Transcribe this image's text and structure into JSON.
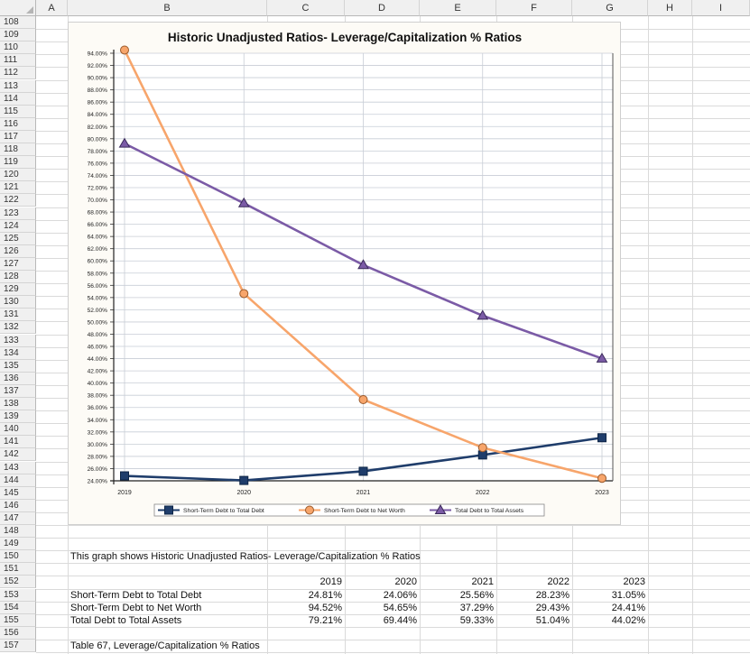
{
  "columns": [
    {
      "id": "corner",
      "label": ""
    },
    {
      "id": "A",
      "label": "A"
    },
    {
      "id": "B",
      "label": "B"
    },
    {
      "id": "C",
      "label": "C"
    },
    {
      "id": "D",
      "label": "D"
    },
    {
      "id": "E",
      "label": "E"
    },
    {
      "id": "F",
      "label": "F"
    },
    {
      "id": "G",
      "label": "G"
    },
    {
      "id": "H",
      "label": "H"
    },
    {
      "id": "I",
      "label": "I"
    }
  ],
  "rows": [
    "108",
    "109",
    "110",
    "111",
    "112",
    "113",
    "114",
    "115",
    "116",
    "117",
    "118",
    "119",
    "120",
    "121",
    "122",
    "123",
    "124",
    "125",
    "126",
    "127",
    "128",
    "129",
    "130",
    "131",
    "132",
    "133",
    "134",
    "135",
    "136",
    "137",
    "138",
    "139",
    "140",
    "141",
    "142",
    "143",
    "144",
    "145",
    "146",
    "147",
    "148",
    "149",
    "150",
    "151",
    "152",
    "153",
    "154",
    "155",
    "156",
    "157"
  ],
  "description": "This graph shows Historic Unadjusted Ratios- Leverage/Capitalization % Ratios",
  "table": {
    "years": [
      "2019",
      "2020",
      "2021",
      "2022",
      "2023"
    ],
    "rows": [
      {
        "label": "Short-Term Debt to Total Debt",
        "values": [
          "24.81%",
          "24.06%",
          "25.56%",
          "28.23%",
          "31.05%"
        ]
      },
      {
        "label": "Short-Term Debt to Net Worth",
        "values": [
          "94.52%",
          "54.65%",
          "37.29%",
          "29.43%",
          "24.41%"
        ]
      },
      {
        "label": "Total Debt to Total Assets",
        "values": [
          "79.21%",
          "69.44%",
          "59.33%",
          "51.04%",
          "44.02%"
        ]
      }
    ]
  },
  "caption": "Table 67, Leverage/Capitalization % Ratios",
  "chart_data": {
    "type": "line",
    "title": "Historic Unadjusted Ratios- Leverage/Capitalization % Ratios",
    "x": [
      "2019",
      "2020",
      "2021",
      "2022",
      "2023"
    ],
    "ylim": [
      24,
      94
    ],
    "yticks": [
      "94.00%",
      "92.00%",
      "90.00%",
      "88.00%",
      "86.00%",
      "84.00%",
      "82.00%",
      "80.00%",
      "78.00%",
      "76.00%",
      "74.00%",
      "72.00%",
      "70.00%",
      "68.00%",
      "66.00%",
      "64.00%",
      "62.00%",
      "60.00%",
      "58.00%",
      "56.00%",
      "54.00%",
      "52.00%",
      "50.00%",
      "48.00%",
      "46.00%",
      "44.00%",
      "42.00%",
      "40.00%",
      "38.00%",
      "36.00%",
      "34.00%",
      "32.00%",
      "30.00%",
      "28.00%",
      "26.00%",
      "24.00%"
    ],
    "grid": true,
    "legend_position": "bottom",
    "series": [
      {
        "name": "Short-Term Debt to Total Debt",
        "values": [
          24.81,
          24.06,
          25.56,
          28.23,
          31.05
        ],
        "color": "#1f3d6b",
        "marker": "square"
      },
      {
        "name": "Short-Term Debt to Net Worth",
        "values": [
          94.52,
          54.65,
          37.29,
          29.43,
          24.41
        ],
        "color": "#f7a56b",
        "marker": "circle"
      },
      {
        "name": "Total Debt to Total Assets",
        "values": [
          79.21,
          69.44,
          59.33,
          51.04,
          44.02
        ],
        "color": "#7b5ba6",
        "marker": "triangle"
      }
    ]
  }
}
